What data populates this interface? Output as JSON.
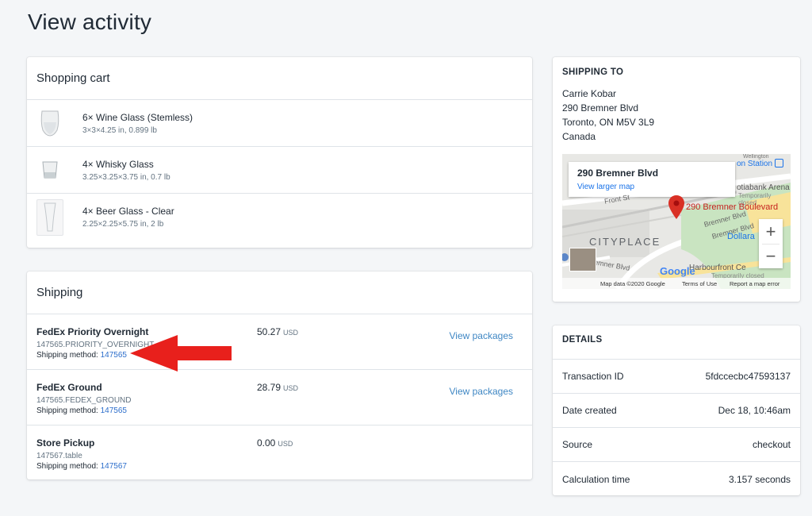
{
  "page": {
    "title": "View activity"
  },
  "cart": {
    "title": "Shopping cart",
    "items": [
      {
        "name": "6× Wine Glass (Stemless)",
        "meta": "3×3×4.25 in, 0.899 lb",
        "icon": "wine-glass-icon"
      },
      {
        "name": "4× Whisky Glass",
        "meta": "3.25×3.25×3.75 in, 0.7 lb",
        "icon": "whisky-glass-icon"
      },
      {
        "name": "4× Beer Glass - Clear",
        "meta": "2.25×2.25×5.75 in, 2 lb",
        "icon": "beer-glass-icon"
      }
    ]
  },
  "shipping": {
    "title": "Shipping",
    "method_label": "Shipping method:",
    "view_label": "View packages",
    "rows": [
      {
        "name": "FedEx Priority Overnight",
        "code": "147565.PRIORITY_OVERNIGHT",
        "method_id": "147565",
        "price": "50.27",
        "currency": "USD",
        "has_view": true
      },
      {
        "name": "FedEx Ground",
        "code": "147565.FEDEX_GROUND",
        "method_id": "147565",
        "price": "28.79",
        "currency": "USD",
        "has_view": true
      },
      {
        "name": "Store Pickup",
        "code": "147567.table",
        "method_id": "147567",
        "price": "0.00",
        "currency": "USD",
        "has_view": false
      }
    ]
  },
  "ship_to": {
    "title": "SHIPPING TO",
    "name": "Carrie Kobar",
    "street": "290 Bremner Blvd",
    "city": "Toronto, ON M5V 3L9",
    "country": "Canada",
    "map": {
      "info_title": "290 Bremner Blvd",
      "info_link": "View larger map",
      "pin_label": "290 Bremner Boulevard",
      "area_label": "CITYPLACE",
      "station": "on Station",
      "arena": "otiabank Arena",
      "arena_note": "Temporarily closed",
      "street1": "Front St",
      "street2": "Bremner Blvd",
      "street3": "Bremner Blvd",
      "street4": "emner Blvd",
      "dollar": "Dollara",
      "harbour": "Harbourfront Ce",
      "harbour_note": "Temporarily closed",
      "street_top": "Wellington",
      "zoom_in": "+",
      "zoom_out": "−",
      "google": "Google",
      "footer_data": "Map data ©2020 Google",
      "footer_terms": "Terms of Use",
      "footer_report": "Report a map error",
      "pin_color": "#d93025"
    }
  },
  "details": {
    "title": "DETAILS",
    "rows": [
      {
        "label": "Transaction ID",
        "value": "5fdccecbc47593137"
      },
      {
        "label": "Date created",
        "value": "Dec 18, 10:46am"
      },
      {
        "label": "Source",
        "value": "checkout"
      },
      {
        "label": "Calculation time",
        "value": "3.157 seconds"
      }
    ]
  },
  "colors": {
    "link": "#3f87c4",
    "annotation_arrow": "#e8201c",
    "background": "#f4f6f8"
  }
}
